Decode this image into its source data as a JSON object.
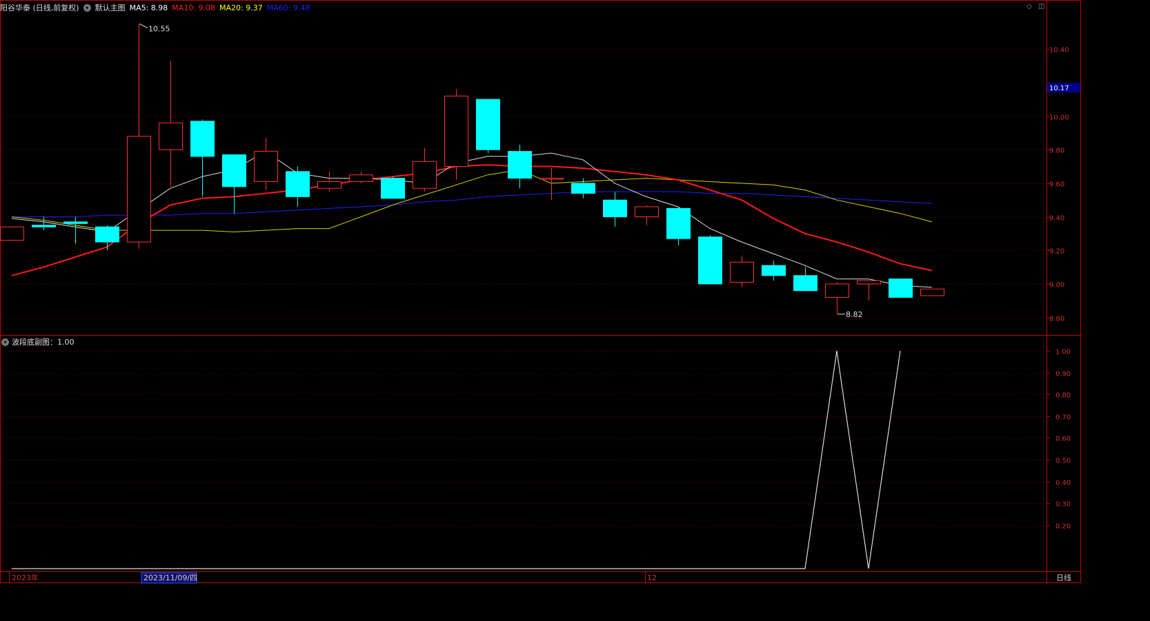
{
  "header": {
    "title": "阳谷华泰 (日线,前复权)",
    "main_chart_label": "默认主图",
    "ma": [
      {
        "label": "MA5: 8.98",
        "color": "#ffffff"
      },
      {
        "label": "MA10: 9.08",
        "color": "#ff2020"
      },
      {
        "label": "MA20: 9.37",
        "color": "#ffff00"
      },
      {
        "label": "MA60: 9.48",
        "color": "#2020ff"
      }
    ]
  },
  "subchart": {
    "label": "波段底副图：1.00"
  },
  "price_axis": {
    "ticks": [
      "10.40",
      "10.00",
      "9.80",
      "9.60",
      "9.40",
      "9.20",
      "9.00",
      "8.80"
    ],
    "current_price": "10.17",
    "ymin": 8.7,
    "ymax": 10.61
  },
  "sub_axis": {
    "ticks": [
      "1.00",
      "0.90",
      "0.80",
      "0.70",
      "0.60",
      "0.50",
      "0.40",
      "0.30",
      "0.20"
    ],
    "ymin": 0,
    "ymax": 1.0
  },
  "annotations": {
    "high": "10.55",
    "low": "8.82"
  },
  "bottom_axis": {
    "year_label": "2023年",
    "cursor_date": "2023/11/09/四",
    "month_label": "12",
    "period_label": "日线"
  },
  "colors": {
    "up": "#ff3232",
    "down": "#00ffff",
    "grid": "#7a0000",
    "axis": "#c00000"
  },
  "chart_data": {
    "type": "candlestick",
    "candles": [
      {
        "o": 9.26,
        "h": 9.34,
        "l": 9.26,
        "c": 9.34
      },
      {
        "o": 9.35,
        "h": 9.4,
        "l": 9.32,
        "c": 9.34
      },
      {
        "o": 9.37,
        "h": 9.4,
        "l": 9.24,
        "c": 9.36
      },
      {
        "o": 9.34,
        "h": 9.35,
        "l": 9.2,
        "c": 9.25
      },
      {
        "o": 9.25,
        "h": 10.55,
        "l": 9.21,
        "c": 9.88
      },
      {
        "o": 9.8,
        "h": 10.33,
        "l": 9.58,
        "c": 9.96
      },
      {
        "o": 9.97,
        "h": 9.98,
        "l": 9.52,
        "c": 9.76
      },
      {
        "o": 9.77,
        "h": 9.77,
        "l": 9.42,
        "c": 9.58
      },
      {
        "o": 9.61,
        "h": 9.87,
        "l": 9.56,
        "c": 9.79
      },
      {
        "o": 9.67,
        "h": 9.7,
        "l": 9.46,
        "c": 9.52
      },
      {
        "o": 9.57,
        "h": 9.67,
        "l": 9.55,
        "c": 9.61
      },
      {
        "o": 9.61,
        "h": 9.67,
        "l": 9.6,
        "c": 9.65
      },
      {
        "o": 9.63,
        "h": 9.64,
        "l": 9.51,
        "c": 9.51
      },
      {
        "o": 9.57,
        "h": 9.81,
        "l": 9.55,
        "c": 9.73
      },
      {
        "o": 9.7,
        "h": 10.16,
        "l": 9.62,
        "c": 10.12
      },
      {
        "o": 10.1,
        "h": 10.1,
        "l": 9.78,
        "c": 9.8
      },
      {
        "o": 9.79,
        "h": 9.83,
        "l": 9.57,
        "c": 9.63
      },
      {
        "o": 9.63,
        "h": 9.69,
        "l": 9.5,
        "c": 9.63
      },
      {
        "o": 9.6,
        "h": 9.63,
        "l": 9.51,
        "c": 9.54
      },
      {
        "o": 9.5,
        "h": 9.55,
        "l": 9.34,
        "c": 9.4
      },
      {
        "o": 9.4,
        "h": 9.47,
        "l": 9.35,
        "c": 9.46
      },
      {
        "o": 9.45,
        "h": 9.46,
        "l": 9.23,
        "c": 9.27
      },
      {
        "o": 9.28,
        "h": 9.29,
        "l": 9.0,
        "c": 9.0
      },
      {
        "o": 9.01,
        "h": 9.17,
        "l": 8.98,
        "c": 9.13
      },
      {
        "o": 9.11,
        "h": 9.14,
        "l": 9.02,
        "c": 9.05
      },
      {
        "o": 9.05,
        "h": 9.1,
        "l": 8.96,
        "c": 8.96
      },
      {
        "o": 8.92,
        "h": 9.01,
        "l": 8.82,
        "c": 9.0
      },
      {
        "o": 9.0,
        "h": 9.02,
        "l": 8.9,
        "c": 9.02
      },
      {
        "o": 9.03,
        "h": 9.03,
        "l": 8.92,
        "c": 8.92
      },
      {
        "o": 8.93,
        "h": 8.97,
        "l": 8.93,
        "c": 8.97
      }
    ],
    "ma5": [
      9.39,
      9.37,
      9.34,
      9.31,
      9.44,
      9.57,
      9.64,
      9.68,
      9.79,
      9.66,
      9.63,
      9.63,
      9.62,
      9.6,
      9.72,
      9.76,
      9.76,
      9.78,
      9.74,
      9.6,
      9.52,
      9.46,
      9.33,
      9.25,
      9.18,
      9.11,
      9.03,
      9.03,
      8.99,
      8.98
    ],
    "ma10": [
      9.05,
      9.1,
      9.16,
      9.22,
      9.36,
      9.47,
      9.51,
      9.52,
      9.54,
      9.56,
      9.59,
      9.62,
      9.64,
      9.66,
      9.7,
      9.71,
      9.7,
      9.7,
      9.69,
      9.67,
      9.65,
      9.62,
      9.56,
      9.5,
      9.39,
      9.3,
      9.25,
      9.19,
      9.12,
      9.08
    ],
    "ma20": [
      9.4,
      9.38,
      9.35,
      9.32,
      9.32,
      9.32,
      9.32,
      9.31,
      9.32,
      9.33,
      9.33,
      9.4,
      9.47,
      9.53,
      9.59,
      9.65,
      9.68,
      9.6,
      9.61,
      9.62,
      9.63,
      9.62,
      9.61,
      9.6,
      9.59,
      9.56,
      9.5,
      9.46,
      9.42,
      9.37
    ],
    "ma60": [
      9.4,
      9.4,
      9.4,
      9.41,
      9.41,
      9.41,
      9.42,
      9.42,
      9.43,
      9.44,
      9.45,
      9.46,
      9.47,
      9.49,
      9.5,
      9.52,
      9.53,
      9.54,
      9.55,
      9.55,
      9.55,
      9.55,
      9.54,
      9.54,
      9.53,
      9.52,
      9.51,
      9.5,
      9.49,
      9.48
    ],
    "band_bottom": [
      0,
      0,
      0,
      0,
      0,
      0,
      0,
      0,
      0,
      0,
      0,
      0,
      0,
      0,
      0,
      0,
      0,
      0,
      0,
      0,
      0,
      0,
      0,
      0,
      0,
      0,
      1,
      0,
      1
    ]
  }
}
